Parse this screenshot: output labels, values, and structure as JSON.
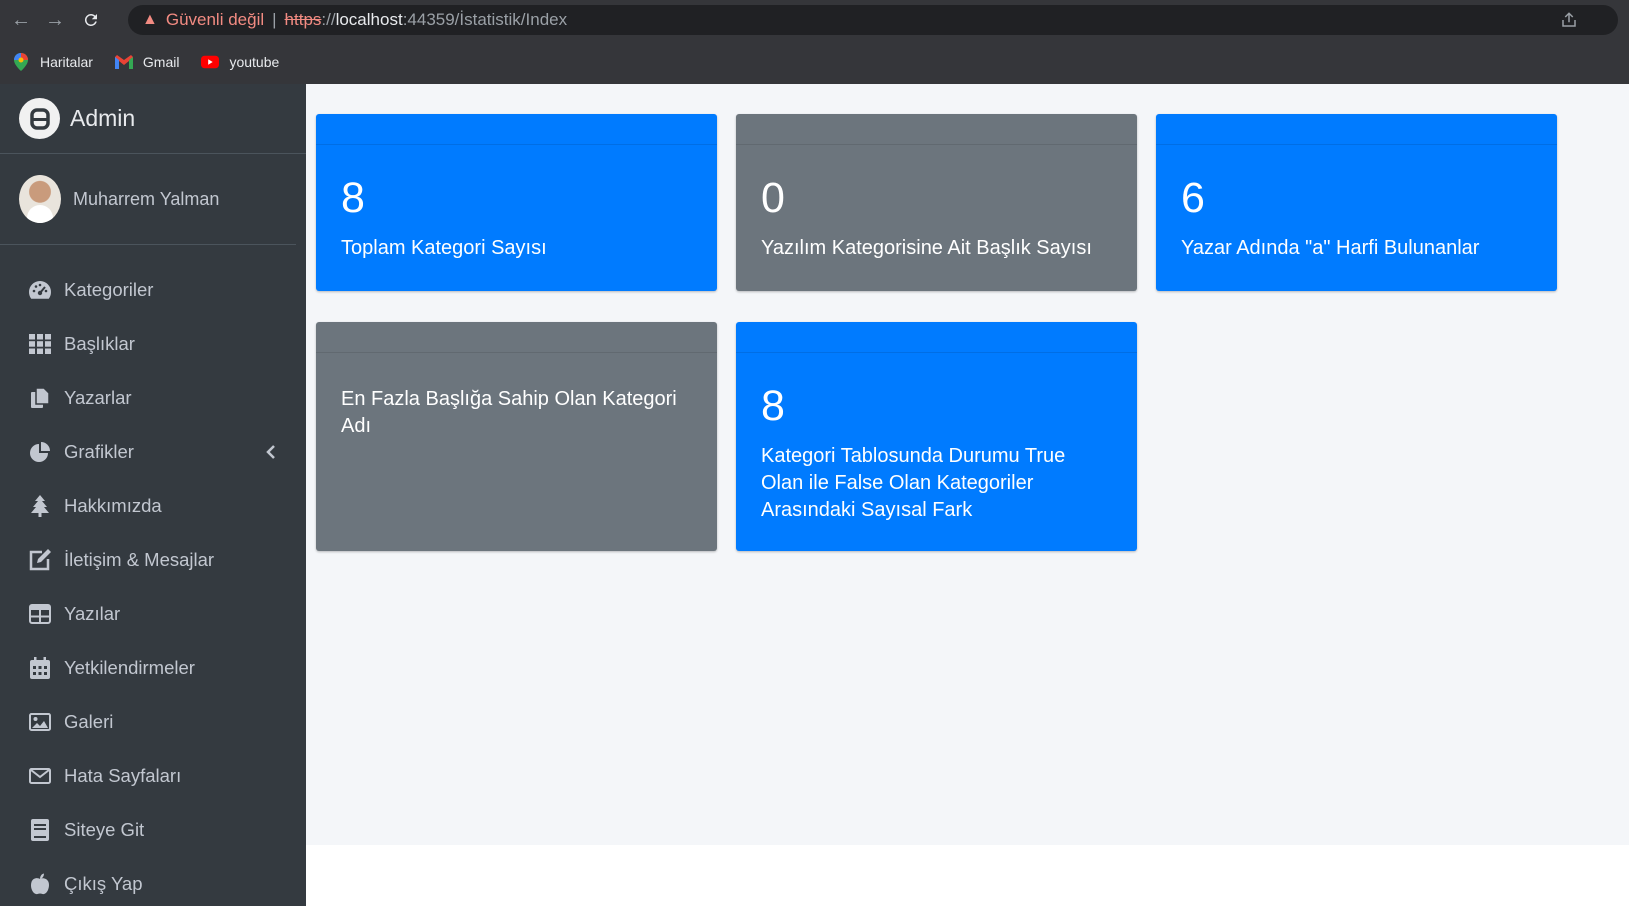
{
  "browser": {
    "warning": "Güvenli değil",
    "separator": "|",
    "url_scheme": "https",
    "url_sep": "://",
    "url_host": "localhost",
    "url_rest": ":44359/İstatistik/Index",
    "bookmarks": [
      {
        "label": "Haritalar",
        "icon": "maps-icon"
      },
      {
        "label": "Gmail",
        "icon": "gmail-icon"
      },
      {
        "label": "youtube",
        "icon": "youtube-icon"
      }
    ]
  },
  "sidebar": {
    "brand": "Admin",
    "user_name": "Muharrem Yalman",
    "items": [
      {
        "label": "Kategoriler",
        "icon": "dashboard-icon"
      },
      {
        "label": "Başlıklar",
        "icon": "grid-icon"
      },
      {
        "label": "Yazarlar",
        "icon": "copy-icon"
      },
      {
        "label": "Grafikler",
        "icon": "pie-chart-icon"
      },
      {
        "label": "Hakkımızda",
        "icon": "tree-icon"
      },
      {
        "label": "İletişim & Mesajlar",
        "icon": "edit-icon"
      },
      {
        "label": "Yazılar",
        "icon": "table-icon"
      },
      {
        "label": "Yetkilendirmeler",
        "icon": "calendar-icon"
      },
      {
        "label": "Galeri",
        "icon": "image-icon"
      },
      {
        "label": "Hata Sayfaları",
        "icon": "envelope-icon"
      },
      {
        "label": "Siteye Git",
        "icon": "book-icon"
      },
      {
        "label": "Çıkış Yap",
        "icon": "apple-icon"
      }
    ]
  },
  "cards": [
    {
      "number": "8",
      "label": "Toplam Kategori Sayısı",
      "color": "#007bff"
    },
    {
      "number": "0",
      "label": "Yazılım Kategorisine Ait Başlık Sayısı",
      "color": "#6c757d"
    },
    {
      "number": "6",
      "label": "Yazar Adında \"a\" Harfi Bulunanlar",
      "color": "#007bff"
    },
    {
      "number": "",
      "label": "En Fazla Başlığa Sahip Olan Kategori Adı",
      "color": "#6c757d"
    },
    {
      "number": "8",
      "label": "Kategori Tablosunda Durumu True Olan ile False Olan Kategoriler Arasındaki Sayısal Fark",
      "color": "#007bff"
    }
  ]
}
